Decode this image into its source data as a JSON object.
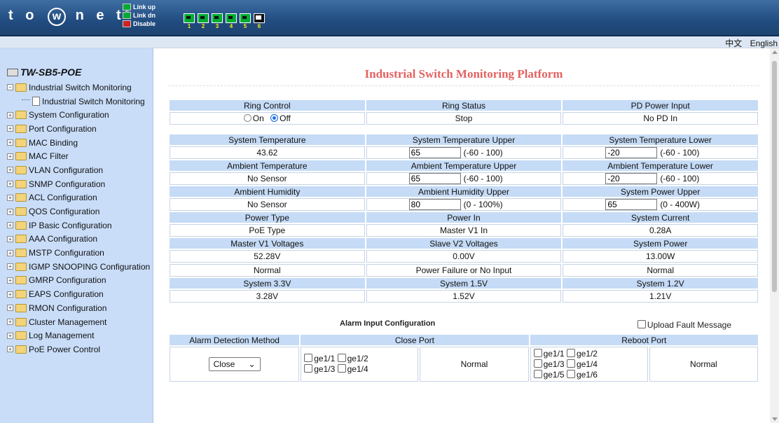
{
  "header": {
    "logo_t": "t",
    "logo_o": "o",
    "logo_w": "w",
    "logo_rest": "n e t",
    "legend": [
      "Link up",
      "Link dn",
      "Disable"
    ],
    "legend_colors": [
      "#0a3",
      "#0a3",
      "#c22"
    ],
    "ports": [
      "1",
      "2",
      "3",
      "4",
      "5",
      "6"
    ]
  },
  "topbar": {
    "lang_zh": "中文",
    "lang_en": "English"
  },
  "sidebar": {
    "root": "TW-SB5-POE",
    "open_folder": "Industrial Switch Monitoring",
    "open_child": "Industrial Switch Monitoring",
    "items": [
      "System Configuration",
      "Port Configuration",
      "MAC Binding",
      "MAC Filter",
      "VLAN Configuration",
      "SNMP Configuration",
      "ACL Configuration",
      "QOS Configuration",
      "IP Basic Configuration",
      "AAA Configuration",
      "MSTP Configuration",
      "IGMP SNOOPING Configuration",
      "GMRP Configuration",
      "EAPS Configuration",
      "RMON Configuration",
      "Cluster Management",
      "Log Management",
      "PoE Power Control"
    ]
  },
  "main": {
    "title": "Industrial Switch Monitoring Platform",
    "ring": {
      "h1": "Ring Control",
      "h2": "Ring Status",
      "h3": "PD Power Input",
      "on": "On",
      "off": "Off",
      "status": "Stop",
      "pd": "No PD In"
    },
    "temp": {
      "h1": "System Temperature",
      "h2": "System Temperature Upper",
      "h3": "System Temperature Lower",
      "v1": "43.62",
      "upper": "65",
      "upper_range": "(-60 - 100)",
      "lower": "-20",
      "lower_range": "(-60 - 100)"
    },
    "ambient": {
      "h1": "Ambient Temperature",
      "h2": "Ambient Temperature Upper",
      "h3": "Ambient Temperature Lower",
      "v1": "No Sensor",
      "upper": "65",
      "upper_range": "(-60 - 100)",
      "lower": "-20",
      "lower_range": "(-60 - 100)"
    },
    "humidity": {
      "h1": "Ambient Humidity",
      "h2": "Ambient Humidity Upper",
      "h3": "System Power Upper",
      "v1": "No Sensor",
      "upper": "80",
      "upper_range": "(0 - 100%)",
      "power": "65",
      "power_range": "(0 - 400W)"
    },
    "power": {
      "h1": "Power Type",
      "h2": "Power In",
      "h3": "System Current",
      "v1": "PoE Type",
      "v2": "Master V1 In",
      "v3": "0.28A"
    },
    "voltage": {
      "h1": "Master V1 Voltages",
      "h2": "Slave V2 Voltages",
      "h3": "System Power",
      "v1": "52.28V",
      "v2": "0.00V",
      "v3": "13.00W",
      "s1": "Normal",
      "s2": "Power Failure or No Input",
      "s3": "Normal"
    },
    "rails": {
      "h1": "System 3.3V",
      "h2": "System 1.5V",
      "h3": "System 1.2V",
      "v1": "3.28V",
      "v2": "1.52V",
      "v3": "1.21V"
    },
    "alarm": {
      "title": "Alarm Input Configuration",
      "upload": "Upload Fault Message",
      "h1": "Alarm Detection Method",
      "h2": "Close Port",
      "h3": "Reboot Port",
      "method": "Close",
      "close_ports": [
        "ge1/1",
        "ge1/2",
        "ge1/3",
        "ge1/4"
      ],
      "close_status": "Normal",
      "reboot_ports": [
        "ge1/1",
        "ge1/2",
        "ge1/3",
        "ge1/4",
        "ge1/5",
        "ge1/6"
      ],
      "reboot_status": "Normal"
    }
  }
}
